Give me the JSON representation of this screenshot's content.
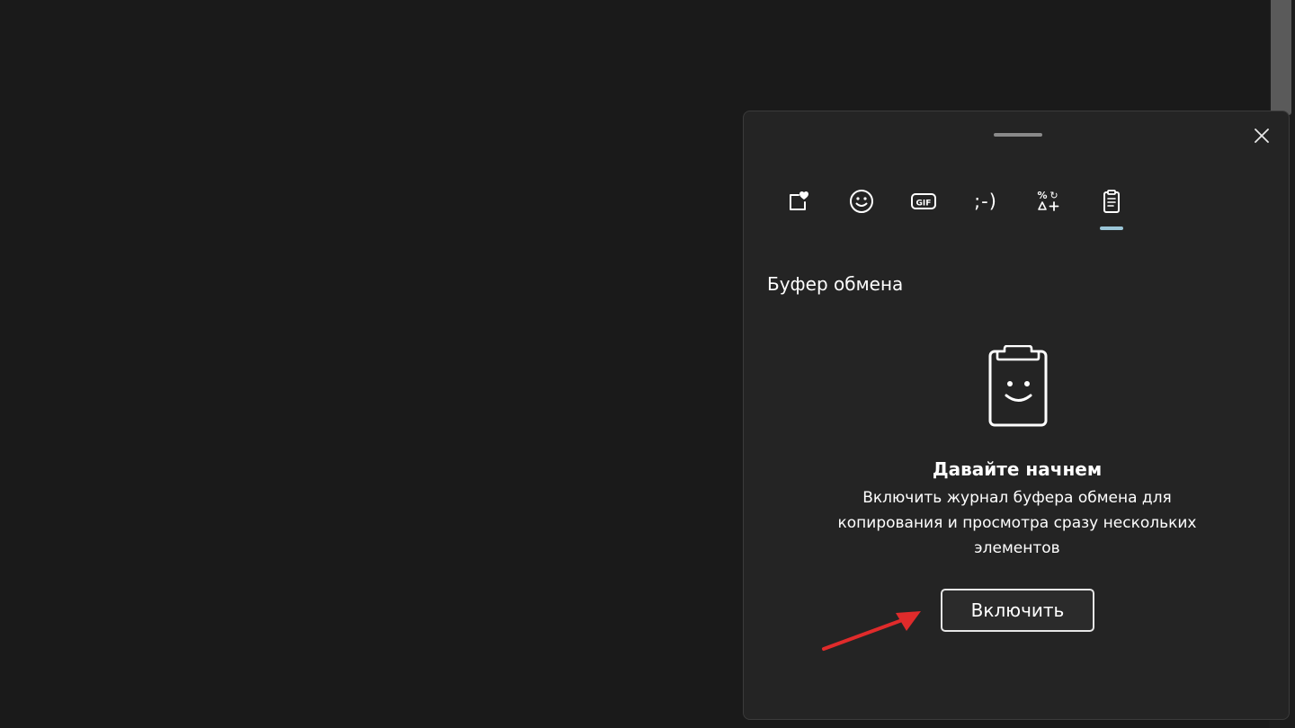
{
  "panel": {
    "title": "Буфер обмена",
    "tabs": [
      {
        "name": "kaomoji-favorites",
        "icon": "heart-sticker-icon"
      },
      {
        "name": "emoji",
        "icon": "smiley-icon"
      },
      {
        "name": "gif",
        "icon": "gif-icon"
      },
      {
        "name": "kaomoji",
        "icon": "kaomoji-icon",
        "label": ";-)"
      },
      {
        "name": "symbols",
        "icon": "symbols-icon"
      },
      {
        "name": "clipboard",
        "icon": "clipboard-icon",
        "active": true
      }
    ],
    "empty_state": {
      "heading": "Давайте начнем",
      "description": "Включить журнал буфера обмена для копирования и просмотра сразу нескольких элементов",
      "button_label": "Включить"
    }
  },
  "colors": {
    "background": "#1a1a1a",
    "panel": "#242424",
    "accent_indicator": "#9bc6d8",
    "annotation_arrow": "#e02b2b"
  }
}
